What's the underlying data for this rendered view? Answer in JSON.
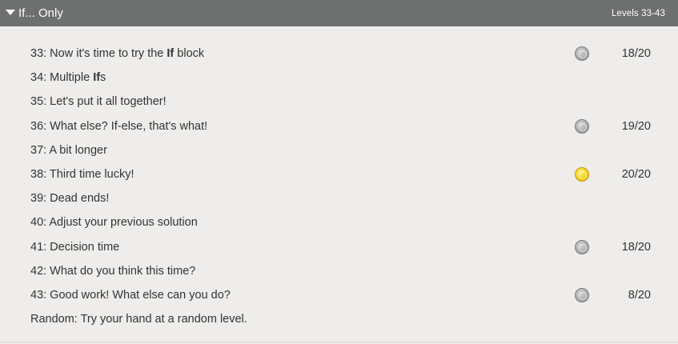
{
  "section": {
    "title": "If... Only",
    "range": "Levels 33-43"
  },
  "levels": [
    {
      "pre": "33: Now it's time to try the ",
      "bold": "If",
      "post": " block",
      "medal": "silver",
      "score": "18/20"
    },
    {
      "pre": "34: Multiple ",
      "bold": "If",
      "post": "s",
      "medal": "",
      "score": ""
    },
    {
      "pre": "35: Let's put it all together!",
      "bold": "",
      "post": "",
      "medal": "",
      "score": ""
    },
    {
      "pre": "36: What else? If-else, that's what!",
      "bold": "",
      "post": "",
      "medal": "silver",
      "score": "19/20"
    },
    {
      "pre": "37: A bit longer",
      "bold": "",
      "post": "",
      "medal": "",
      "score": ""
    },
    {
      "pre": "38: Third time lucky!",
      "bold": "",
      "post": "",
      "medal": "gold",
      "score": "20/20"
    },
    {
      "pre": "39: Dead ends!",
      "bold": "",
      "post": "",
      "medal": "",
      "score": ""
    },
    {
      "pre": "40: Adjust your previous solution",
      "bold": "",
      "post": "",
      "medal": "",
      "score": ""
    },
    {
      "pre": "41: Decision time",
      "bold": "",
      "post": "",
      "medal": "silver",
      "score": "18/20"
    },
    {
      "pre": "42: What do you think this time?",
      "bold": "",
      "post": "",
      "medal": "",
      "score": ""
    },
    {
      "pre": "43: Good work! What else can you do?",
      "bold": "",
      "post": "",
      "medal": "silver",
      "score": "8/20"
    },
    {
      "pre": "Random: Try your hand at a random level.",
      "bold": "",
      "post": "",
      "medal": "",
      "score": ""
    }
  ]
}
